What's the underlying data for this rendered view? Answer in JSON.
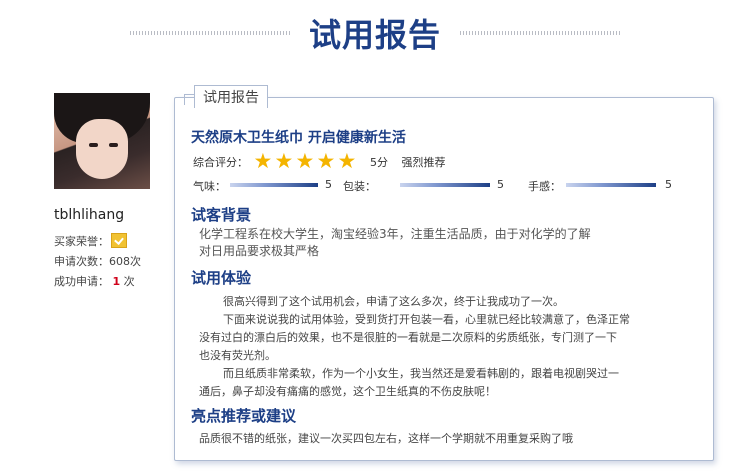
{
  "header": {
    "title": "试用报告"
  },
  "user": {
    "name": "tblhlihang",
    "honor_label": "买家荣誉：",
    "apply_label": "申请次数：",
    "apply_value": "608次",
    "success_label": "成功申请：",
    "success_count": "1",
    "success_unit": "次"
  },
  "report": {
    "tab": "试用报告",
    "product_title": "天然原木卫生纸巾 开启健康新生活",
    "rating": {
      "label": "综合评分：",
      "stars": 5,
      "score": "5分",
      "verdict": "强烈推荐"
    },
    "metrics": [
      {
        "label": "气味：",
        "value": "5"
      },
      {
        "label": "包装：",
        "value": "5"
      },
      {
        "label": "手感：",
        "value": "5"
      }
    ],
    "background": {
      "heading": "试客背景",
      "lines": [
        "化学工程系在校大学生，淘宝经验3年，注重生活品质，由于对化学的了解",
        "对日用品要求极其严格"
      ]
    },
    "experience": {
      "heading": "试用体验",
      "lines": [
        "很高兴得到了这个试用机会，申请了这么多次，终于让我成功了一次。",
        "下面来说说我的试用体验，受到货打开包装一看，心里就已经比较满意了，色泽正常",
        "没有过白的漂白后的效果，也不是很脏的一看就是二次原料的劣质纸张，专门测了一下",
        "也没有荧光剂。",
        "而且纸质非常柔软，作为一个小女生，我当然还是爱看韩剧的，跟着电视剧哭过一",
        "通后，鼻子却没有痛痛的感觉，这个卫生纸真的不伤皮肤呢！"
      ]
    },
    "recommend": {
      "heading": "亮点推荐或建议",
      "text": "品质很不错的纸张，建议一次买四包左右，这样一个学期就不用重复采购了哦"
    }
  }
}
